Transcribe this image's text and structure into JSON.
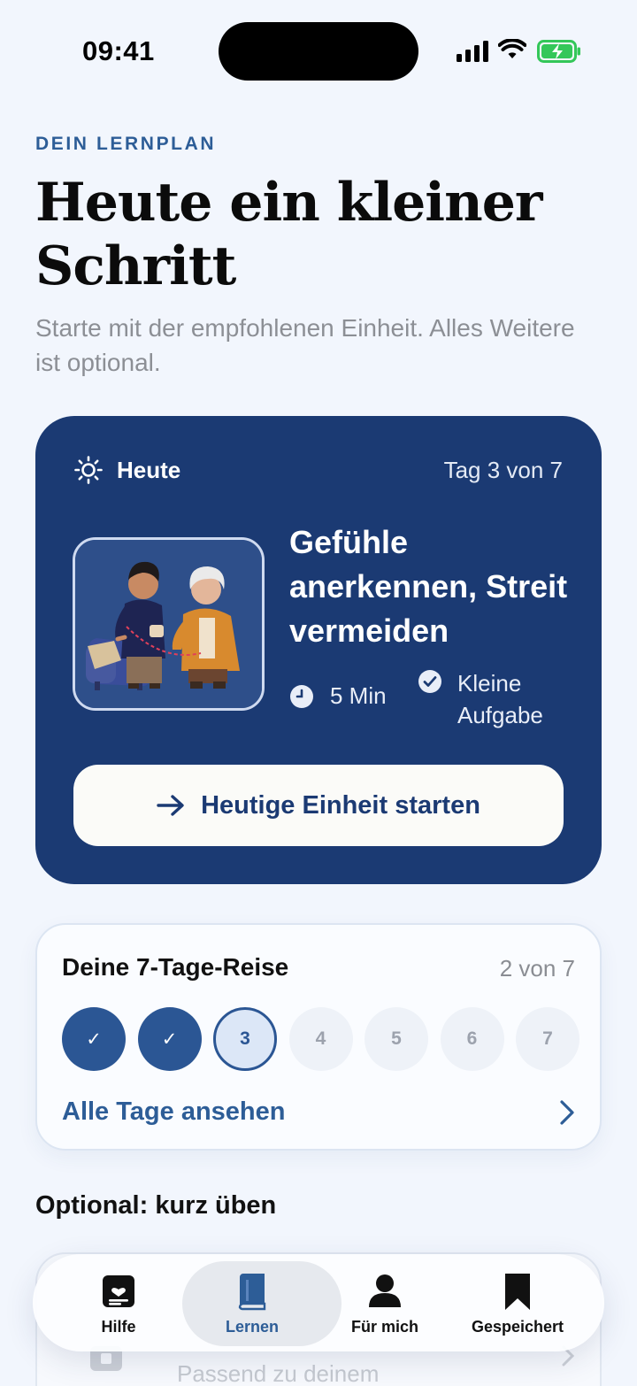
{
  "status_bar": {
    "time": "09:41"
  },
  "header": {
    "eyebrow": "DEIN LERNPLAN",
    "title": "Heute ein kleiner Schritt",
    "subtitle": "Starte mit der empfohlenen Einheit. Alles Weitere ist optional."
  },
  "today_card": {
    "label": "Heute",
    "day_of": "Tag 3 von 7",
    "lesson_title": "Gefühle anerkennen, Streit vermeiden",
    "duration": "5 Min",
    "task": "Kleine Aufgabe",
    "start_button": "Heutige Einheit starten",
    "colors": {
      "background": "#1b3a73",
      "button": "#fbfbf8"
    }
  },
  "journey": {
    "title": "Deine 7-Tage-Reise",
    "progress": "2 von 7",
    "progress_value": {
      "done": 2,
      "total": 7,
      "current": 3
    },
    "days": [
      {
        "label": "✓",
        "state": "done"
      },
      {
        "label": "✓",
        "state": "done"
      },
      {
        "label": "3",
        "state": "current"
      },
      {
        "label": "4",
        "state": "future"
      },
      {
        "label": "5",
        "state": "future"
      },
      {
        "label": "6",
        "state": "future"
      },
      {
        "label": "7",
        "state": "future"
      }
    ],
    "all_days_link": "Alle Tage ansehen"
  },
  "optional": {
    "section_title": "Optional: kurz üben",
    "peek_subtitle": "Passend zu deinem"
  },
  "tab_bar": {
    "tabs": [
      {
        "label": "Hilfe",
        "icon": "heart-note-icon",
        "active": false
      },
      {
        "label": "Lernen",
        "icon": "book-icon",
        "active": true
      },
      {
        "label": "Für mich",
        "icon": "person-icon",
        "active": false
      },
      {
        "label": "Gespeichert",
        "icon": "bookmark-icon",
        "active": false
      }
    ]
  },
  "colors": {
    "accent": "#2d5d97",
    "page_background": "#f2f6fd",
    "battery": "#34c759"
  }
}
